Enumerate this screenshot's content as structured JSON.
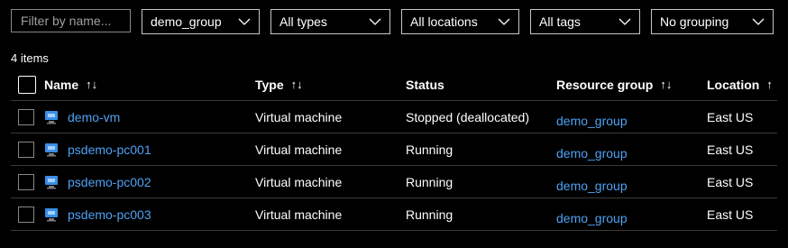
{
  "filters": {
    "name_placeholder": "Filter by name...",
    "resource_group": "demo_group",
    "type": "All types",
    "location": "All locations",
    "tags": "All tags",
    "grouping": "No grouping"
  },
  "item_count": "4 items",
  "columns": {
    "name": "Name",
    "type": "Type",
    "status": "Status",
    "resource_group": "Resource group",
    "location": "Location"
  },
  "sort_icons": {
    "both": "↑↓",
    "asc": "↑"
  },
  "rows": [
    {
      "name": "demo-vm",
      "type": "Virtual machine",
      "status": "Stopped (deallocated)",
      "resource_group": "demo_group",
      "location": "East US"
    },
    {
      "name": "psdemo-pc001",
      "type": "Virtual machine",
      "status": "Running",
      "resource_group": "demo_group",
      "location": "East US"
    },
    {
      "name": "psdemo-pc002",
      "type": "Virtual machine",
      "status": "Running",
      "resource_group": "demo_group",
      "location": "East US"
    },
    {
      "name": "psdemo-pc003",
      "type": "Virtual machine",
      "status": "Running",
      "resource_group": "demo_group",
      "location": "East US"
    }
  ],
  "colors": {
    "background": "#000000",
    "link": "#4ea1f3",
    "border": "#3b3a39",
    "vm_icon": "#3a8ee6"
  },
  "icons": {
    "row_icon": "virtual-machine-icon",
    "dropdown_icon": "chevron-down-icon",
    "sort_icon": "sort-arrows-icon"
  }
}
